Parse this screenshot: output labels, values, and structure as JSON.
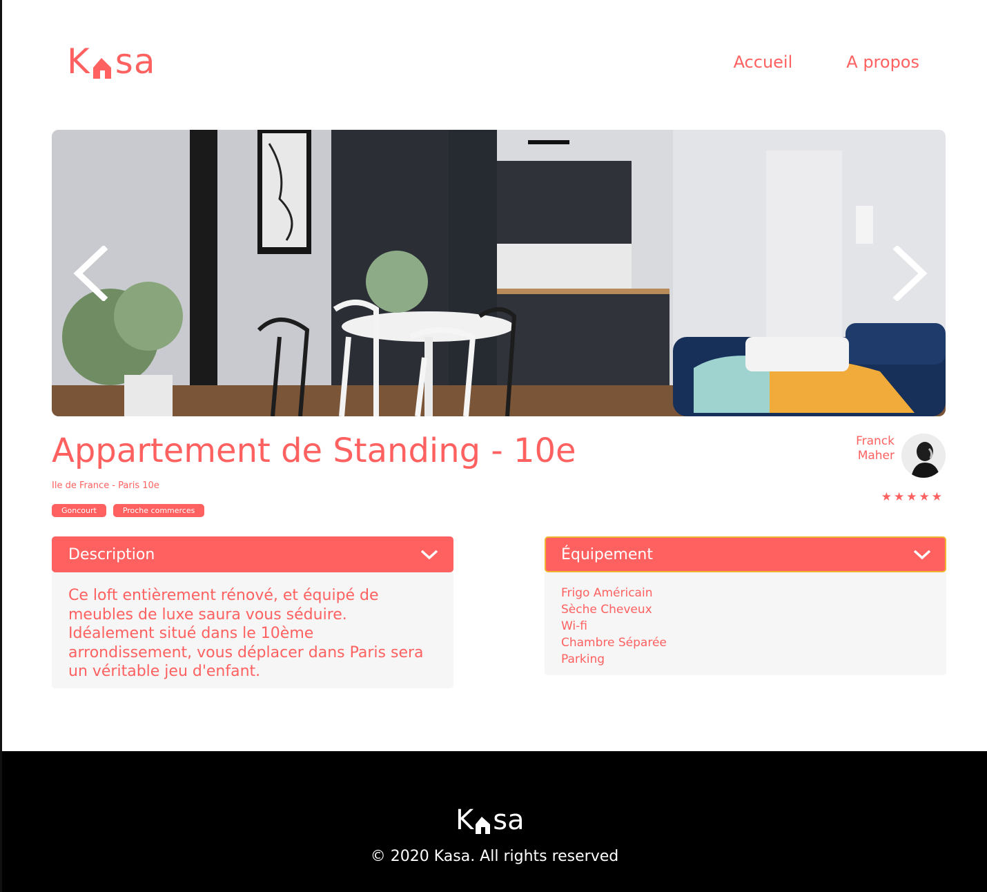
{
  "brand": {
    "logo_left": "K",
    "logo_right": "sa",
    "accent_color": "#ff6060"
  },
  "nav": {
    "items": [
      {
        "label": "Accueil"
      },
      {
        "label": "A propos"
      }
    ]
  },
  "carousel": {
    "prev_icon": "chevron-left-icon",
    "next_icon": "chevron-right-icon"
  },
  "listing": {
    "title": "Appartement de Standing - 10e",
    "location": "Ile de France - Paris 10e",
    "tags": [
      "Goncourt",
      "Proche commerces"
    ],
    "rating": 5,
    "rating_max": 5
  },
  "host": {
    "first_name": "Franck",
    "last_name": "Maher"
  },
  "description": {
    "title": "Description",
    "text": "Ce loft entièrement rénové, et équipé de meubles de luxe saura vous séduire. Idéalement situé dans le 10ème arrondissement, vous déplacer dans Paris sera un véritable jeu d'enfant."
  },
  "equipment": {
    "title": "Équipement",
    "items": [
      "Frigo Américain",
      "Sèche Cheveux",
      "Wi-fi",
      "Chambre Séparée",
      "Parking"
    ]
  },
  "footer": {
    "logo_left": "K",
    "logo_right": "sa",
    "copyright": "© 2020 Kasa. All rights reserved"
  }
}
